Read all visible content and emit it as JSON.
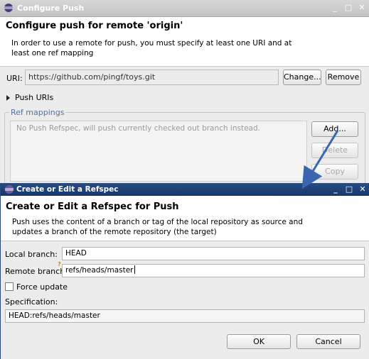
{
  "back_window": {
    "title": "Configure Push",
    "window_controls": [
      "_",
      "□",
      "✕"
    ],
    "heading": "Configure push for remote 'origin'",
    "description": "In order to use a remote for push, you must specify at least one URI and at least one ref mapping",
    "uri_label": "URI:",
    "uri_value": "https://github.com/pingf/toys.git",
    "change_button": "Change...",
    "remove_button": "Remove",
    "push_uris_label": "Push URIs",
    "ref_mappings_title": "Ref mappings",
    "ref_mappings_message": "No Push Refspec, will push currently checked out branch instead.",
    "add_button": "Add...",
    "delete_button": "Delete",
    "copy_button": "Copy"
  },
  "dialog": {
    "title": "Create or Edit a Refspec",
    "window_controls": [
      "_",
      "□",
      "✕"
    ],
    "heading": "Create or Edit a Refspec for Push",
    "description": "Push uses the content of a branch or tag of the local repository as source and updates a branch of the remote repository (the target)",
    "local_branch_label": "Local branch:",
    "local_branch_value": "HEAD",
    "remote_branch_label": "Remote branch:",
    "remote_branch_value": "refs/heads/master",
    "force_update_label": "Force update",
    "force_update_checked": false,
    "specification_label": "Specification:",
    "specification_value": "HEAD:refs/heads/master",
    "ok_button": "OK",
    "cancel_button": "Cancel"
  },
  "colors": {
    "active_title": "#1f4277",
    "inactive_title": "#c8c8c8",
    "arrow": "#3a66b0",
    "group_title": "#5a6f9c"
  }
}
